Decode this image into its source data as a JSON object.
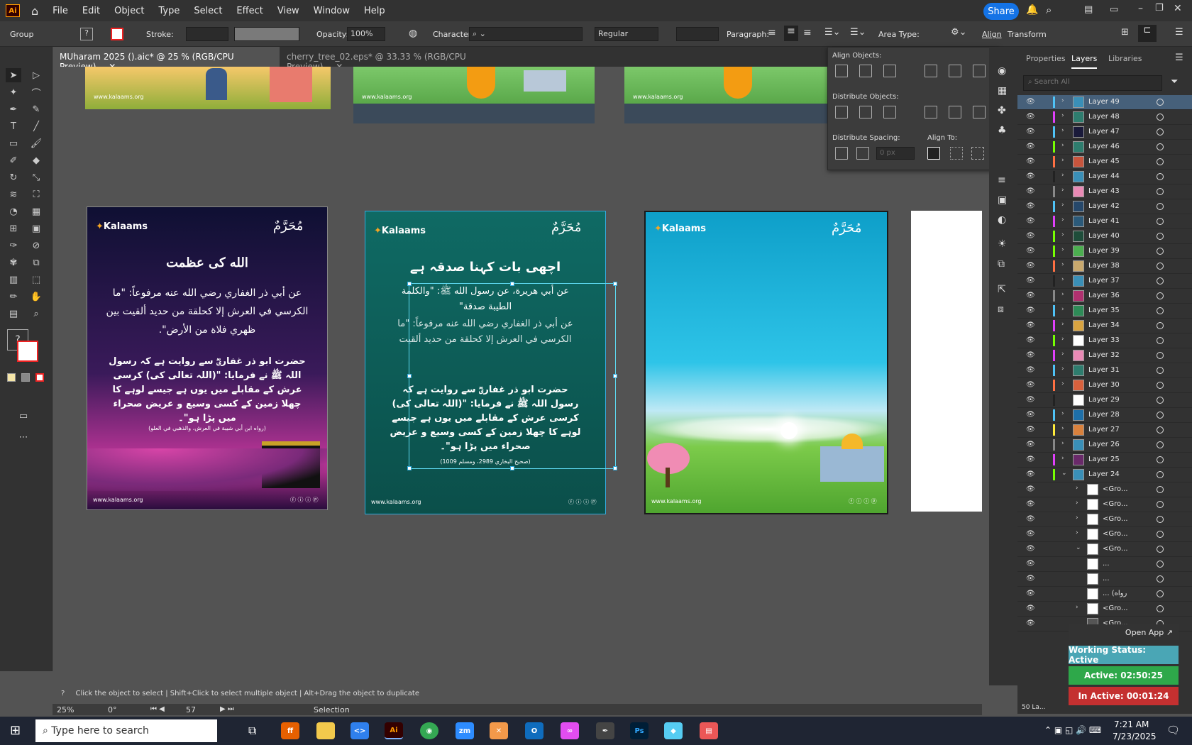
{
  "app": {
    "logo": "Ai"
  },
  "menu": [
    "File",
    "Edit",
    "Object",
    "Type",
    "Select",
    "Effect",
    "View",
    "Window",
    "Help"
  ],
  "share_label": "Share",
  "control": {
    "selection": "Group",
    "stroke_label": "Stroke:",
    "opacity_label": "Opacity:",
    "opacity_value": "100%",
    "character_label": "Character:",
    "font_style": "Regular",
    "paragraph_label": "Paragraph:",
    "area_type_label": "Area Type:",
    "align_label": "Align",
    "transform_label": "Transform"
  },
  "doc_tabs": [
    {
      "label": "MUharam 2025 ().aic* @ 25 % (RGB/CPU Preview)"
    },
    {
      "label": "cherry_tree_02.eps* @ 33.33 % (RGB/CPU Preview)"
    }
  ],
  "align_panel": {
    "align_objects": "Align Objects:",
    "distribute_objects": "Distribute Objects:",
    "distribute_spacing": "Distribute Spacing:",
    "align_to": "Align To:",
    "spacing_value": "0 px"
  },
  "right_panel": {
    "tabs": [
      "Properties",
      "Layers",
      "Libraries"
    ],
    "search_placeholder": "Search All",
    "footer_count": "50 La..."
  },
  "layers": [
    {
      "name": "Layer 49",
      "color": "#4fc3f7",
      "arrow": "›",
      "thumb": "#3a8fb7"
    },
    {
      "name": "Layer 48",
      "color": "#e040fb",
      "arrow": "›",
      "thumb": "#2e7d6e"
    },
    {
      "name": "Layer 47",
      "color": "#4fc3f7",
      "arrow": "›",
      "thumb": "#1a1a3a"
    },
    {
      "name": "Layer 46",
      "color": "#76ff03",
      "arrow": "›",
      "thumb": "#2e7d6e"
    },
    {
      "name": "Layer 45",
      "color": "#ff7043",
      "arrow": "›",
      "thumb": "#c8553d"
    },
    {
      "name": "Layer 44",
      "color": "#222222",
      "arrow": "›",
      "thumb": "#3a8fb7"
    },
    {
      "name": "Layer 43",
      "color": "#888888",
      "arrow": "›",
      "thumb": "#e98ab5"
    },
    {
      "name": "Layer 42",
      "color": "#4fc3f7",
      "arrow": "›",
      "thumb": "#26486b"
    },
    {
      "name": "Layer 41",
      "color": "#e040fb",
      "arrow": "›",
      "thumb": "#2b5a7a"
    },
    {
      "name": "Layer 40",
      "color": "#76ff03",
      "arrow": "›",
      "thumb": "#1e4d3a"
    },
    {
      "name": "Layer 39",
      "color": "#76ff03",
      "arrow": "›",
      "thumb": "#4caf50"
    },
    {
      "name": "Layer 38",
      "color": "#ff7043",
      "arrow": "›",
      "thumb": "#c9a96e"
    },
    {
      "name": "Layer 37",
      "color": "#222222",
      "arrow": "›",
      "thumb": "#3a8fb7"
    },
    {
      "name": "Layer 36",
      "color": "#888888",
      "arrow": "›",
      "thumb": "#b0306f"
    },
    {
      "name": "Layer 35",
      "color": "#4fc3f7",
      "arrow": "›",
      "thumb": "#2e8b57"
    },
    {
      "name": "Layer 34",
      "color": "#e040fb",
      "arrow": "›",
      "thumb": "#d9a441"
    },
    {
      "name": "Layer 33",
      "color": "#76ff03",
      "arrow": "›",
      "thumb": "#ffffff"
    },
    {
      "name": "Layer 32",
      "color": "#e040fb",
      "arrow": "›",
      "thumb": "#e98ab5"
    },
    {
      "name": "Layer 31",
      "color": "#4fc3f7",
      "arrow": "›",
      "thumb": "#2e7d6e"
    },
    {
      "name": "Layer 30",
      "color": "#ff7043",
      "arrow": "›",
      "thumb": "#d9613d"
    },
    {
      "name": "Layer 29",
      "color": "#222222",
      "arrow": "",
      "thumb": "#ffffff"
    },
    {
      "name": "Layer 28",
      "color": "#4fc3f7",
      "arrow": "›",
      "thumb": "#1e6fa8"
    },
    {
      "name": "Layer 27",
      "color": "#ffeb3b",
      "arrow": "›",
      "thumb": "#d9813d"
    },
    {
      "name": "Layer 26",
      "color": "#888888",
      "arrow": "›",
      "thumb": "#3a8fb7"
    },
    {
      "name": "Layer 25",
      "color": "#e040fb",
      "arrow": "›",
      "thumb": "#6a2a6a"
    },
    {
      "name": "Layer 24",
      "color": "#76ff03",
      "arrow": "⌄",
      "thumb": "#3a8fb7"
    },
    {
      "name": "<Gro...",
      "color": "",
      "arrow": "›",
      "thumb": "#ffffff"
    },
    {
      "name": "<Gro...",
      "color": "",
      "arrow": "›",
      "thumb": "#ffffff"
    },
    {
      "name": "<Gro...",
      "color": "",
      "arrow": "›",
      "thumb": "#ffffff"
    },
    {
      "name": "<Gro...",
      "color": "",
      "arrow": "›",
      "thumb": "#ffffff"
    },
    {
      "name": "<Gro...",
      "color": "",
      "arrow": "⌄",
      "thumb": "#ffffff"
    },
    {
      "name": "...",
      "color": "",
      "arrow": "",
      "thumb": "#ffffff"
    },
    {
      "name": "...",
      "color": "",
      "arrow": "",
      "thumb": "#ffffff"
    },
    {
      "name": "... (رواه",
      "color": "",
      "arrow": "",
      "thumb": "#ffffff"
    },
    {
      "name": "<Gro...",
      "color": "",
      "arrow": "›",
      "thumb": "#ffffff"
    },
    {
      "name": "<Gro...",
      "color": "",
      "arrow": "",
      "thumb": "#555555"
    }
  ],
  "widget": {
    "open_app": "Open App ↗",
    "working_status": "Working Status: Active",
    "active": "Active: 02:50:25",
    "inactive": "In Active: 00:01:24"
  },
  "hint_bar": "Click the object to select  |  Shift+Click to select multiple object  |  Alt+Drag the object to duplicate",
  "status": {
    "zoom": "25%",
    "rotation": "0°",
    "artboard": "57",
    "tool": "Selection"
  },
  "artboards": {
    "brand": "Kalaams",
    "badge": "مُحَرَّمٌ",
    "website": "www.kalaams.org",
    "social": "ⓕ ⓘ ⓘ ⓟ",
    "a1_title": "الله کی عظمت",
    "a1_arabic": "عن أبي ذر الغفاري رضي الله عنه مرفوعاً: \"ما الكرسي في العرش إلا كحلقة من حديد ألقيت بين ظهري فلاة من الأرض\".",
    "a1_urdu": "حضرت ابو ذر غفاریؓ سے روایت ہے کہ رسول اللہ ﷺ نے فرمایا: \"(اللہ تعالی کی) کرسی عرش کے مقابلے میں یوں ہے جیسے لوہے کا چھلا زمین کے کسی وسیع و عریض صحراء میں پڑا ہو\"۔",
    "a1_ref": "(رواه ابن أبي شيبة في العرش، والذهبي في العلو)",
    "a2_title": "اچھی بات کہنا صدقہ ہے",
    "a2_overlay1": "عن أبي هريرة، عن رسول الله ﷺ: \"والكلمة الطيبة صدقة\"",
    "a2_overlay2": "عن أبي ذر الغفاري رضي الله عنه مرفوعاً: \"ما الكرسي في العرش إلا كحلقة من حديد ألقيت",
    "a2_overlay3": "حضرت ابو ذر غفاریؓ سے روایت ہے کہ رسول اللہ ﷺ نے فرمایا: \"(اللہ تعالی کی) کرسی عرش کے مقابلے میں یوں ہے جیسے لوہے کا چھلا زمین کے کسی وسیع و عریض صحراء میں پڑا ہو\"۔",
    "a2_ref": "(صحیح البخاري 2989، ومسلم 1009)"
  },
  "taskbar": {
    "search_placeholder": "Type here to search",
    "time": "7:21 AM",
    "date": "7/23/2025"
  }
}
